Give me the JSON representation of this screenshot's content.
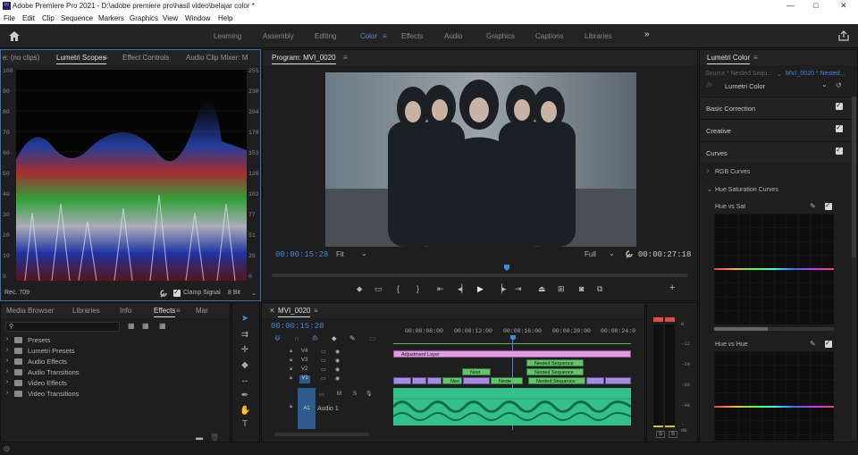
{
  "window": {
    "title": "Adobe Premiere Pro 2021 - D:\\adobe premiere pro\\hasil video\\belajar color *",
    "app_icon": "Pr",
    "controls": [
      "—",
      "□",
      "✕"
    ]
  },
  "menu": [
    "File",
    "Edit",
    "Clip",
    "Sequence",
    "Markers",
    "Graphics",
    "View",
    "Window",
    "Help"
  ],
  "workspaces": [
    "Learning",
    "Assembly",
    "Editing",
    "Color",
    "Effects",
    "Audio",
    "Graphics",
    "Captions",
    "Libraries"
  ],
  "workspace_more": "»",
  "active_workspace": "Color",
  "source_panel": {
    "tabs": [
      "e: (no clips)",
      "Lumetri Scopes",
      "Effect Controls",
      "Audio Clip Mixer: M"
    ],
    "left_scale": [
      "100",
      "90",
      "80",
      "70",
      "60",
      "50",
      "40",
      "30",
      "20",
      "10",
      "0"
    ],
    "right_scale": [
      "255",
      "230",
      "204",
      "178",
      "153",
      "128",
      "102",
      "77",
      "51",
      "26",
      "0"
    ],
    "footer_left": "Rec. 709",
    "clamp_label": "Clamp Signal",
    "bit_depth": "8 Bit"
  },
  "program": {
    "title": "Program: MVI_0020",
    "timecode_current": "00:00:15:28",
    "fit": "Fit",
    "quality": "Full",
    "timecode_duration": "00:00:27:18"
  },
  "project": {
    "tabs": [
      "Media Browser",
      "Libraries",
      "Info",
      "Effects",
      "Mar"
    ],
    "tree": [
      "Presets",
      "Lumetri Presets",
      "Audio Effects",
      "Audio Transitions",
      "Video Effects",
      "Video Transitions"
    ]
  },
  "timeline": {
    "tab": "MVI_0020",
    "timecode": "00:00:15:28",
    "ruler": [
      "00:00:08:00",
      "00:00:12:00",
      "00:00:16:00",
      "00:00:20:00",
      "00:00:24:0"
    ],
    "tracks": [
      {
        "name": "V4"
      },
      {
        "name": "V3"
      },
      {
        "name": "V2"
      },
      {
        "name": "V1"
      }
    ],
    "audio_track": {
      "name": "A1",
      "label": "Audio 1",
      "m": "M",
      "s": "S"
    },
    "clips": {
      "adjustment": "Adjustment Layer",
      "v3_nest": "Nest",
      "v3_nested": "Nested Sequence",
      "v2_nested": "Nested Sequence",
      "v1_a": "Nes",
      "v1_b": "Neste",
      "v1_c": "Nested Sequence"
    }
  },
  "meter": {
    "scale": [
      "0",
      "-12",
      "-24",
      "-36",
      "-48",
      "-dB"
    ],
    "solo": [
      "S",
      "S"
    ]
  },
  "lumetri": {
    "title": "Lumetri Color",
    "source_label": "Source * Nested Sequ...",
    "sequence_label": "MVI_0020 * Nested...",
    "fx": "fx",
    "effect": "Lumetri Color",
    "sections": [
      "Basic Correction",
      "Creative",
      "Curves"
    ],
    "subsections": [
      "RGB Curves",
      "Hue Saturation Curves"
    ],
    "curves": [
      "Hue vs Sat",
      "Hue vs Hue"
    ]
  },
  "colors": {
    "accent": "#3f8ae0",
    "adjustment_clip": "#e49ae8",
    "nested_clip": "#5fc46a",
    "audio_clip": "#33c08a",
    "source_clip": "#a58be4"
  }
}
